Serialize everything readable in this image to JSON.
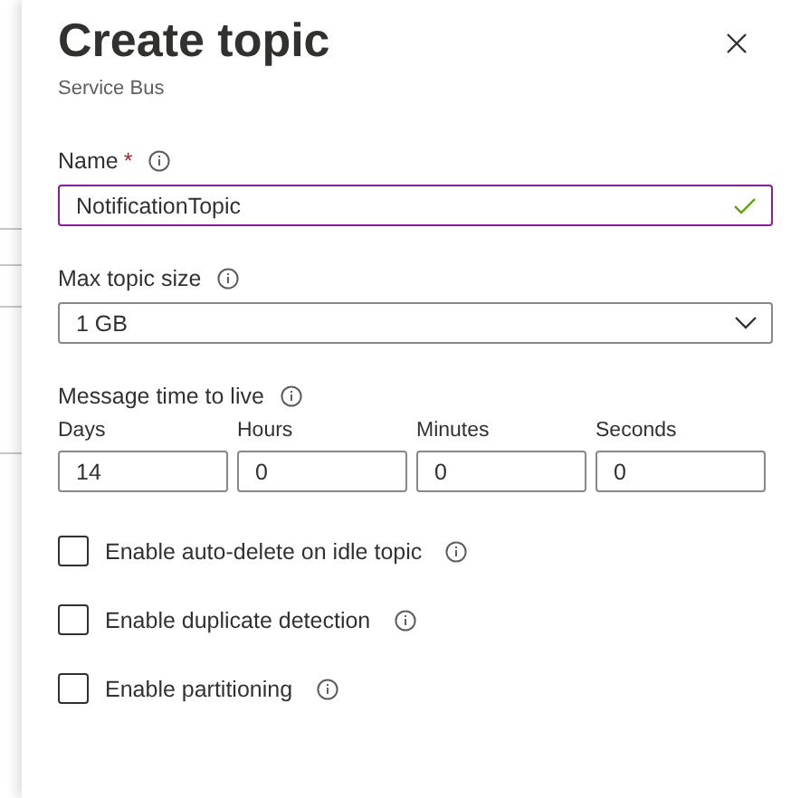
{
  "panel": {
    "title": "Create topic",
    "subtitle": "Service Bus"
  },
  "name_field": {
    "label": "Name",
    "required_mark": "*",
    "value": "NotificationTopic",
    "valid": true
  },
  "size_field": {
    "label": "Max topic size",
    "value": "1 GB"
  },
  "ttl": {
    "label": "Message time to live",
    "fields": [
      {
        "label": "Days",
        "value": "14"
      },
      {
        "label": "Hours",
        "value": "0"
      },
      {
        "label": "Minutes",
        "value": "0"
      },
      {
        "label": "Seconds",
        "value": "0"
      }
    ]
  },
  "options": [
    {
      "label": "Enable auto-delete on idle topic",
      "checked": false
    },
    {
      "label": "Enable duplicate detection",
      "checked": false
    },
    {
      "label": "Enable partitioning",
      "checked": false
    }
  ]
}
